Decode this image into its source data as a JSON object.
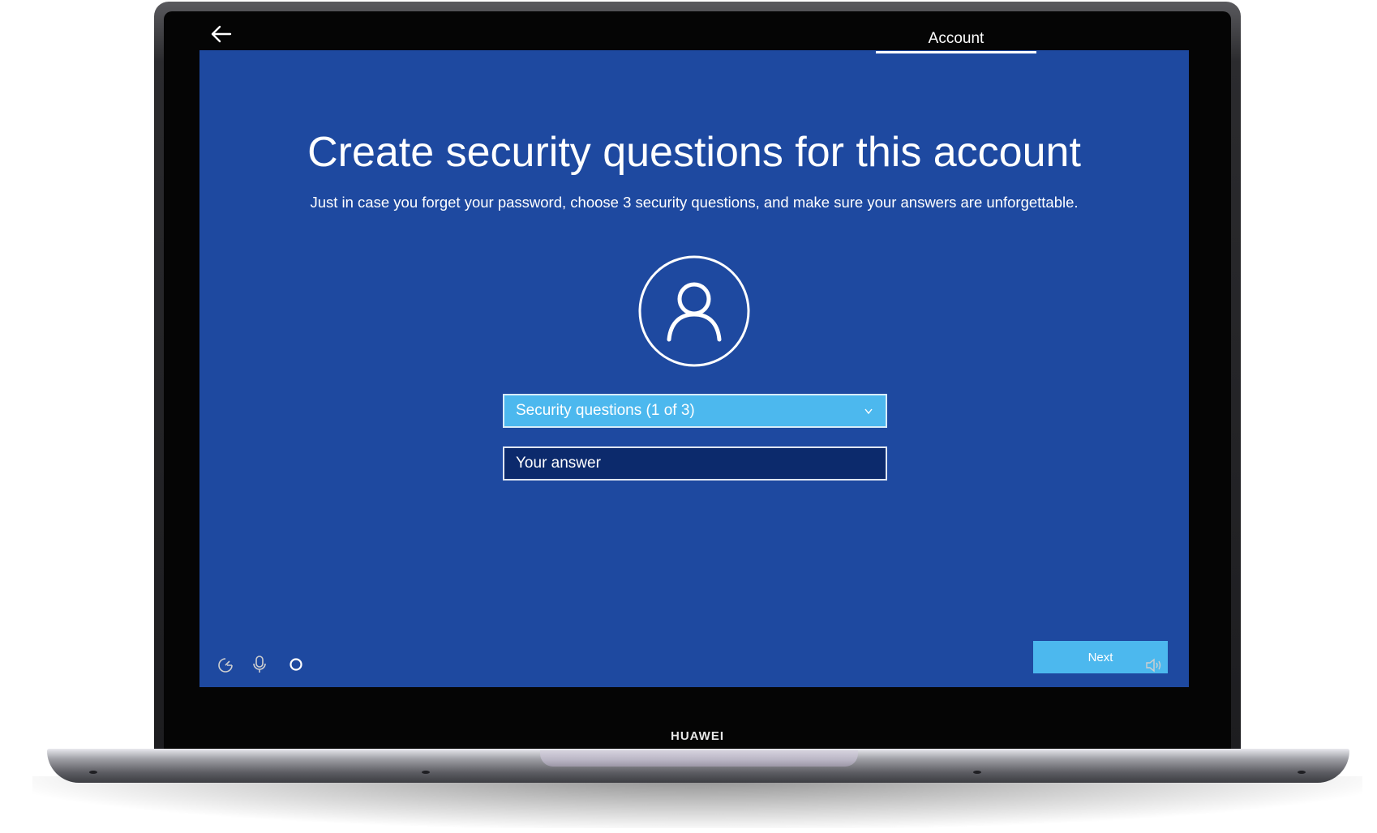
{
  "header": {
    "active_tab": "Account"
  },
  "main": {
    "title": "Create security questions for this account",
    "subtitle": "Just in case you forget your password, choose 3 security questions, and make sure your answers are unforgettable.",
    "security_question_select": {
      "selected": "Security questions (1 of 3)"
    },
    "answer_input": {
      "value": "",
      "placeholder": "Your answer"
    },
    "next_label": "Next"
  },
  "device": {
    "brand": "HUAWEI"
  },
  "tray_icons": [
    "ease-of-access-icon",
    "microphone-icon",
    "cortana-icon",
    "volume-icon"
  ],
  "colors": {
    "screen_background": "#1e49a0",
    "accent": "#4cb8ee",
    "input_background": "#0c2a6c",
    "text": "#ffffff"
  }
}
